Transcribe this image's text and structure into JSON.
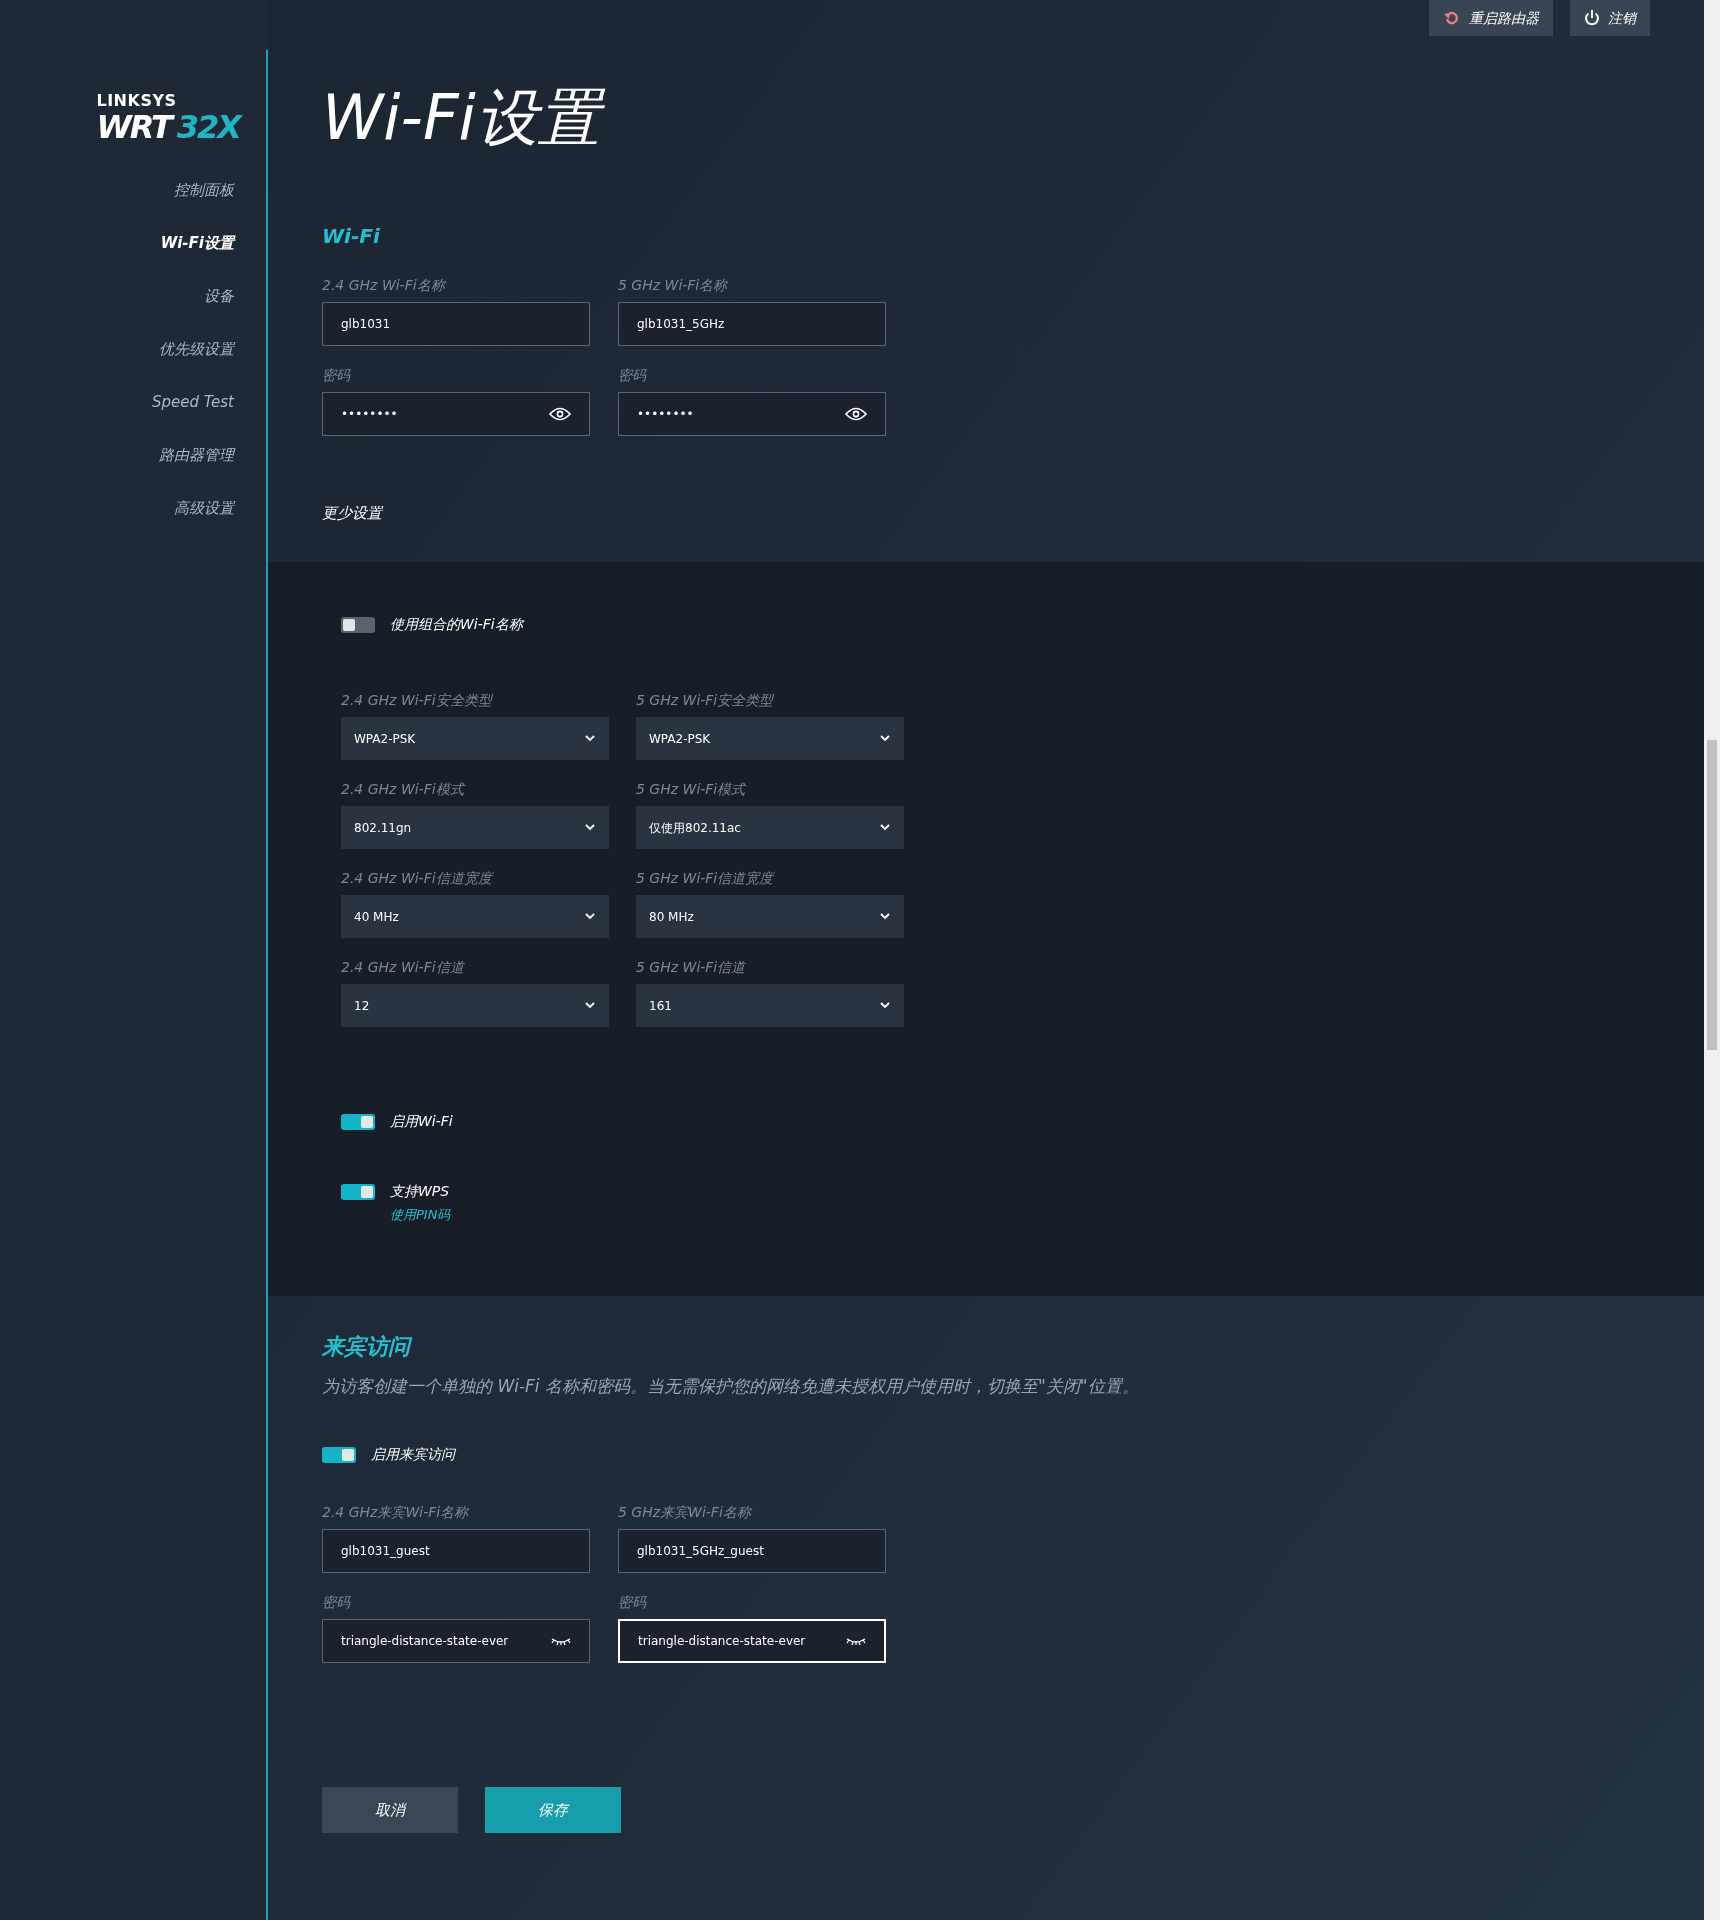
{
  "top_buttons": [
    {
      "label": "重启路由器",
      "kind": "restart"
    },
    {
      "label": "注销",
      "kind": "logout"
    }
  ],
  "sidebar": {
    "logo": {
      "brand": "LINKSYS",
      "model": "WRT",
      "model_accent": "32X"
    },
    "items": [
      {
        "label": "控制面板",
        "selected": false
      },
      {
        "label": "Wi-Fi设置",
        "selected": true
      },
      {
        "label": "设备",
        "selected": false
      },
      {
        "label": "优先级设置",
        "selected": false
      },
      {
        "label": "Speed Test",
        "selected": false
      },
      {
        "label": "路由器管理",
        "selected": false
      },
      {
        "label": "高级设置",
        "selected": false
      }
    ]
  },
  "title": "Wi-Fi设置",
  "wifi": {
    "heading": "Wi-Fi",
    "rows": [
      [
        {
          "label": "2.4 GHz Wi-Fi名称",
          "value": "glb1031",
          "kind": "text",
          "focused": false
        },
        {
          "label": "5 GHz Wi-Fi名称",
          "value": "glb1031_5GHz",
          "kind": "text",
          "focused": false
        }
      ],
      [
        {
          "label": "密码",
          "value": "••••••••",
          "kind": "password",
          "masked": true,
          "focused": false
        },
        {
          "label": "密码",
          "value": "••••••••",
          "kind": "password",
          "masked": true,
          "focused": false
        }
      ]
    ],
    "more_link": "更少设置"
  },
  "advanced": {
    "combined_toggle": {
      "label": "使用组合的Wi-Fi名称",
      "on": false
    },
    "rows": [
      [
        {
          "label": "2.4 GHz Wi-Fi安全类型",
          "value": "WPA2-PSK"
        },
        {
          "label": "5 GHz Wi-Fi安全类型",
          "value": "WPA2-PSK"
        }
      ],
      [
        {
          "label": "2.4 GHz Wi-Fi模式",
          "value": "802.11gn"
        },
        {
          "label": "5 GHz Wi-Fi模式",
          "value": "仅使用802.11ac"
        }
      ],
      [
        {
          "label": "2.4 GHz Wi-Fi信道宽度",
          "value": "40 MHz"
        },
        {
          "label": "5 GHz Wi-Fi信道宽度",
          "value": "80 MHz"
        }
      ],
      [
        {
          "label": "2.4 GHz Wi-Fi信道",
          "value": "12"
        },
        {
          "label": "5 GHz Wi-Fi信道",
          "value": "161"
        }
      ]
    ],
    "toggles": [
      {
        "label": "启用Wi-Fi",
        "on": true
      },
      {
        "label": "支持WPS",
        "on": true,
        "link": "使用PIN码"
      }
    ]
  },
  "guest": {
    "heading": "来宾访问",
    "description": "为访客创建一个单独的 Wi-Fi 名称和密码。当无需保护您的网络免遭未授权用户使用时，切换至\"关闭\"位置。",
    "toggle": {
      "label": "启用来宾访问",
      "on": true
    },
    "rows": [
      [
        {
          "label": "2.4 GHz来宾Wi-Fi名称",
          "value": "glb1031_guest",
          "kind": "text",
          "focused": false
        },
        {
          "label": "5 GHz来宾Wi-Fi名称",
          "value": "glb1031_5GHz_guest",
          "kind": "text",
          "focused": false
        }
      ],
      [
        {
          "label": "密码",
          "value": "triangle-distance-state-ever",
          "kind": "password",
          "masked": false,
          "focused": false
        },
        {
          "label": "密码",
          "value": "triangle-distance-state-ever",
          "kind": "password",
          "masked": false,
          "focused": true
        }
      ]
    ]
  },
  "actions": [
    {
      "label": "取消",
      "kind": "secondary"
    },
    {
      "label": "保存",
      "kind": "primary"
    }
  ]
}
